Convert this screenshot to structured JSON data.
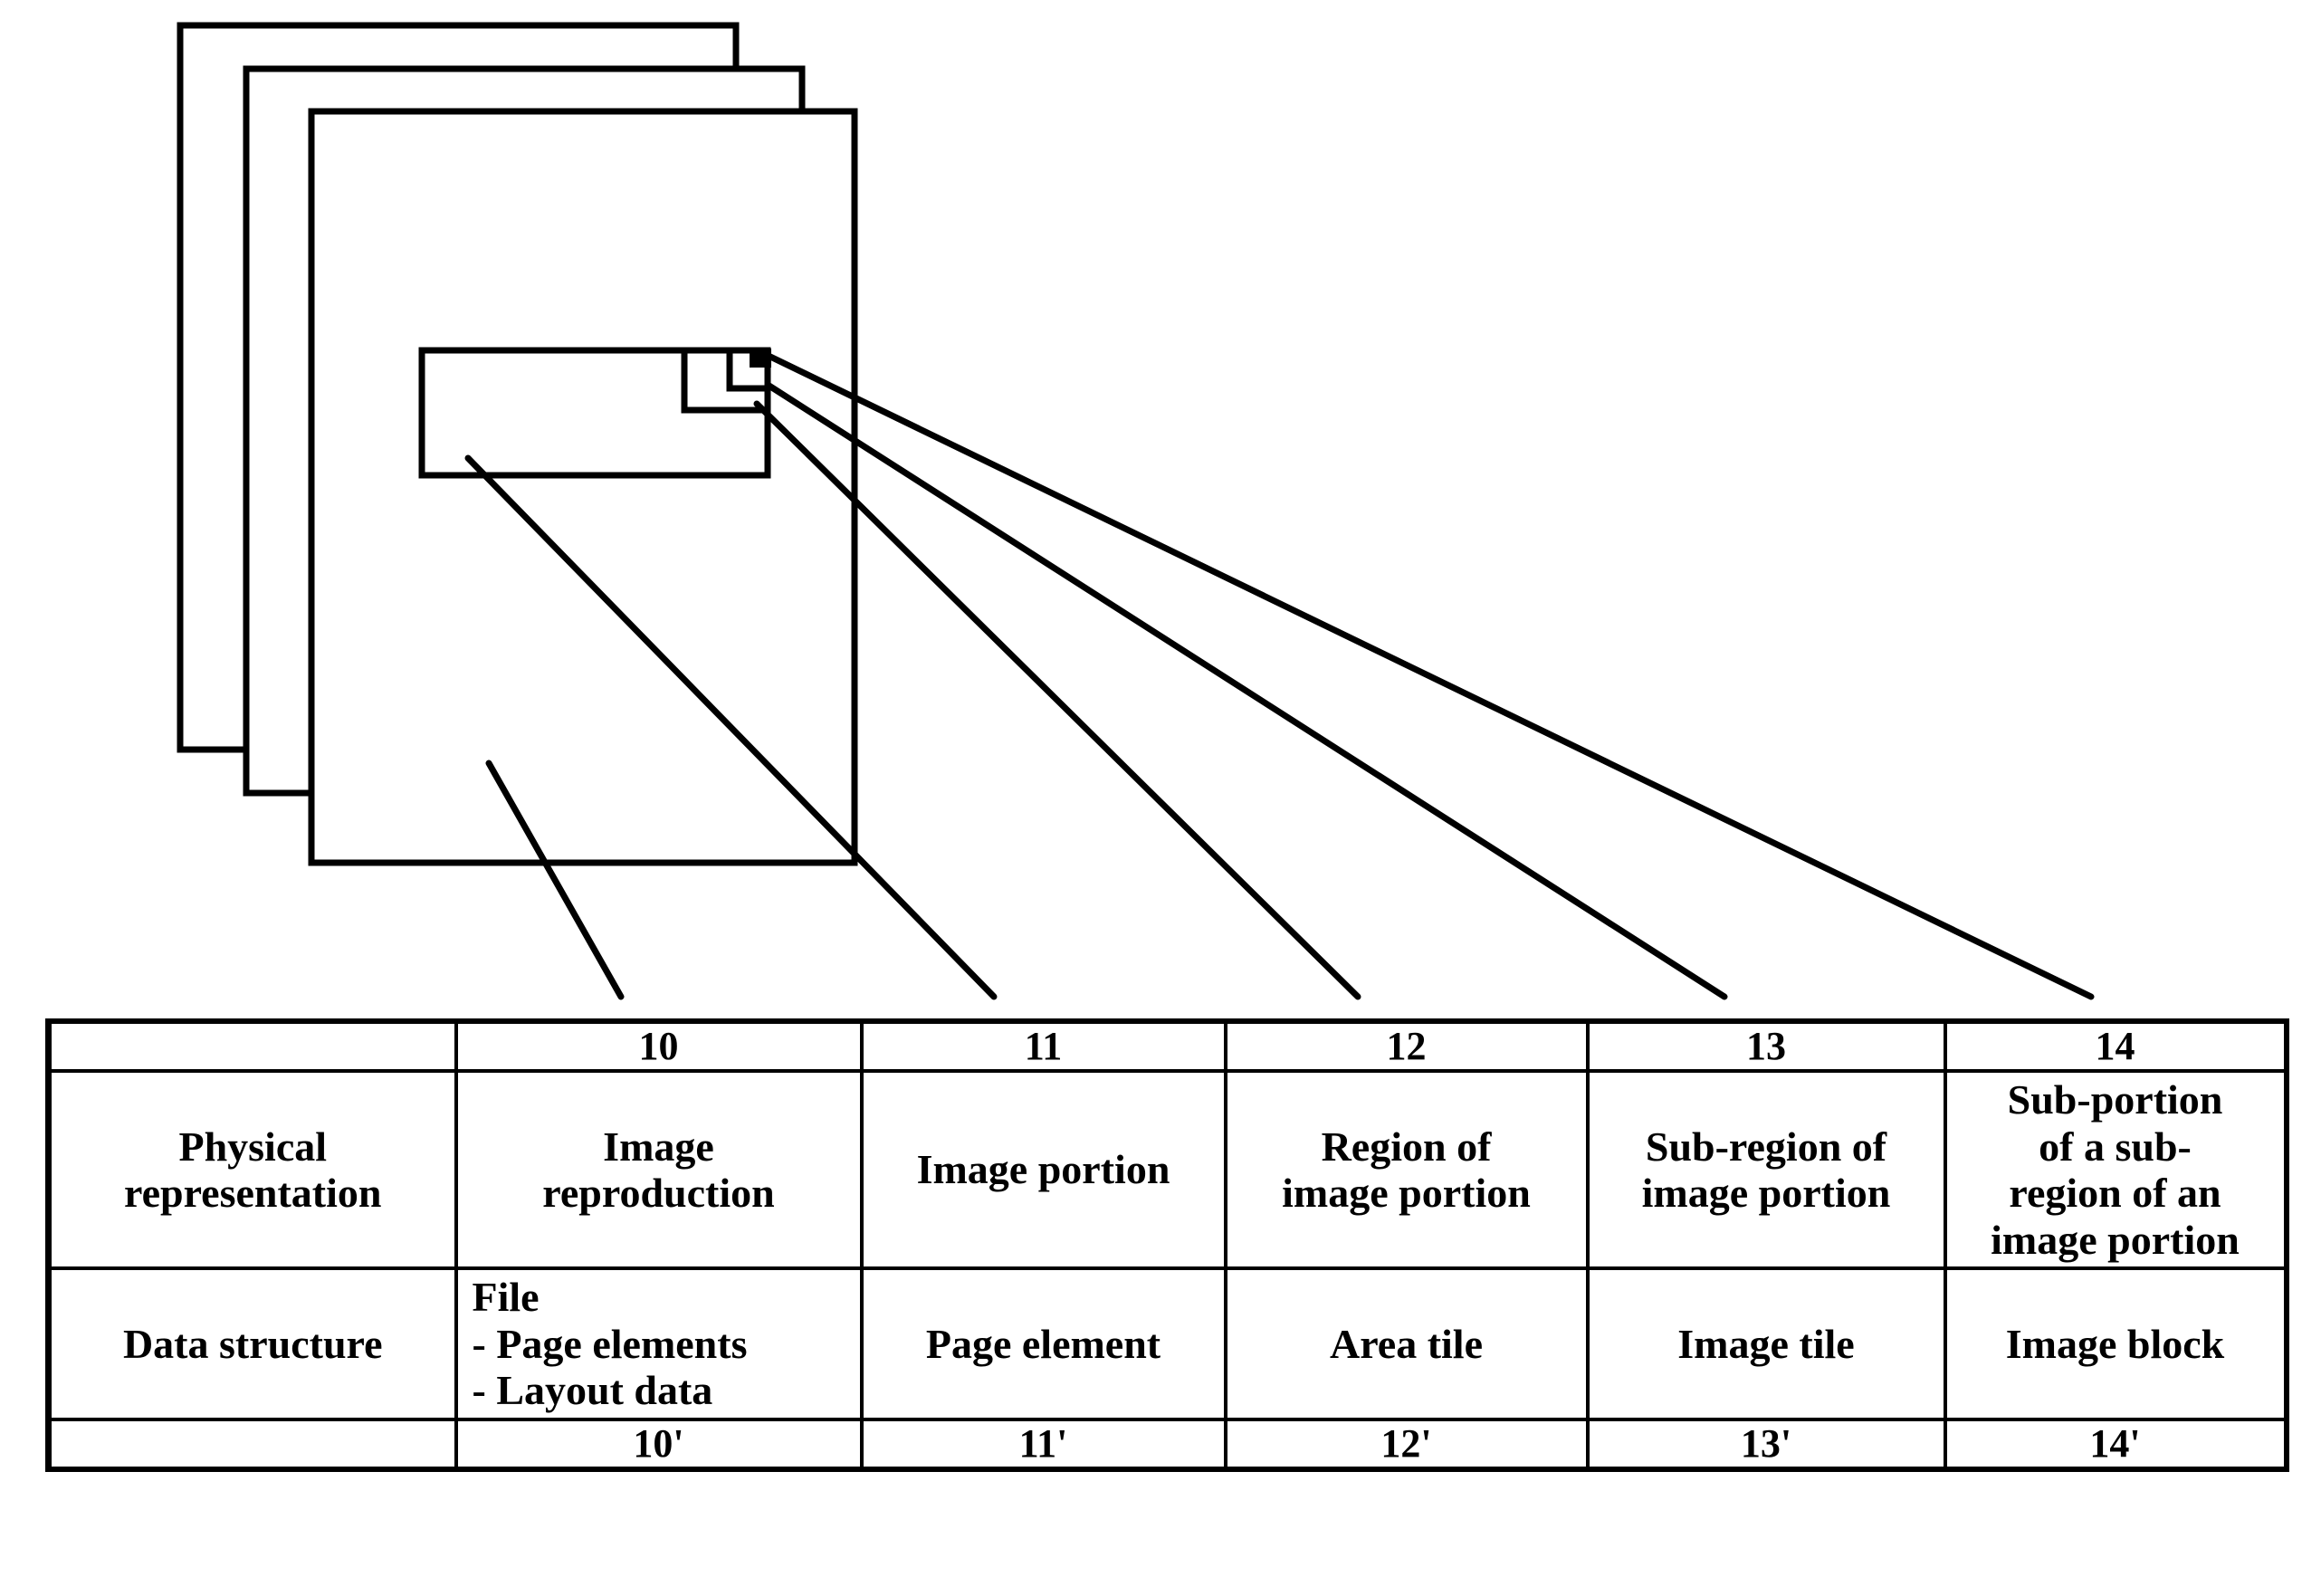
{
  "figure": {
    "page_stack": {
      "name": "stack-of-pages",
      "sheet_count": 3
    },
    "regions": [
      {
        "name": "image-portion",
        "label_ref": "11"
      },
      {
        "name": "area-tile-region",
        "label_ref": "12"
      },
      {
        "name": "image-tile-region",
        "label_ref": "13"
      },
      {
        "name": "image-block",
        "label_ref": "14"
      }
    ],
    "leader_line_count": 5,
    "stroke_color": "#000000"
  },
  "table": {
    "columns": [
      "",
      "10",
      "11",
      "12",
      "13",
      "14"
    ],
    "rows": [
      {
        "kind": "reference-top",
        "cells": [
          "",
          "10",
          "11",
          "12",
          "13",
          "14"
        ]
      },
      {
        "kind": "physical-representation",
        "cells": [
          {
            "lines": [
              "Physical",
              "representation"
            ]
          },
          {
            "lines": [
              "Image",
              "reproduction"
            ]
          },
          {
            "lines": [
              "Image portion"
            ]
          },
          {
            "lines": [
              "Region of",
              "image portion"
            ]
          },
          {
            "lines": [
              "Sub-region of",
              "image portion"
            ]
          },
          {
            "lines": [
              "Sub-portion",
              "of a sub-",
              "region of an",
              "image portion"
            ]
          }
        ]
      },
      {
        "kind": "data-structure",
        "cells": [
          {
            "lines": [
              "Data structure"
            ]
          },
          {
            "lines": [
              "File",
              "- Page elements",
              "- Layout data"
            ],
            "align": "left"
          },
          {
            "lines": [
              "Page element"
            ]
          },
          {
            "lines": [
              "Area tile"
            ]
          },
          {
            "lines": [
              "Image tile"
            ]
          },
          {
            "lines": [
              "Image block"
            ]
          }
        ]
      },
      {
        "kind": "reference-bottom",
        "cells": [
          "",
          "10'",
          "11'",
          "12'",
          "13'",
          "14'"
        ]
      }
    ]
  }
}
